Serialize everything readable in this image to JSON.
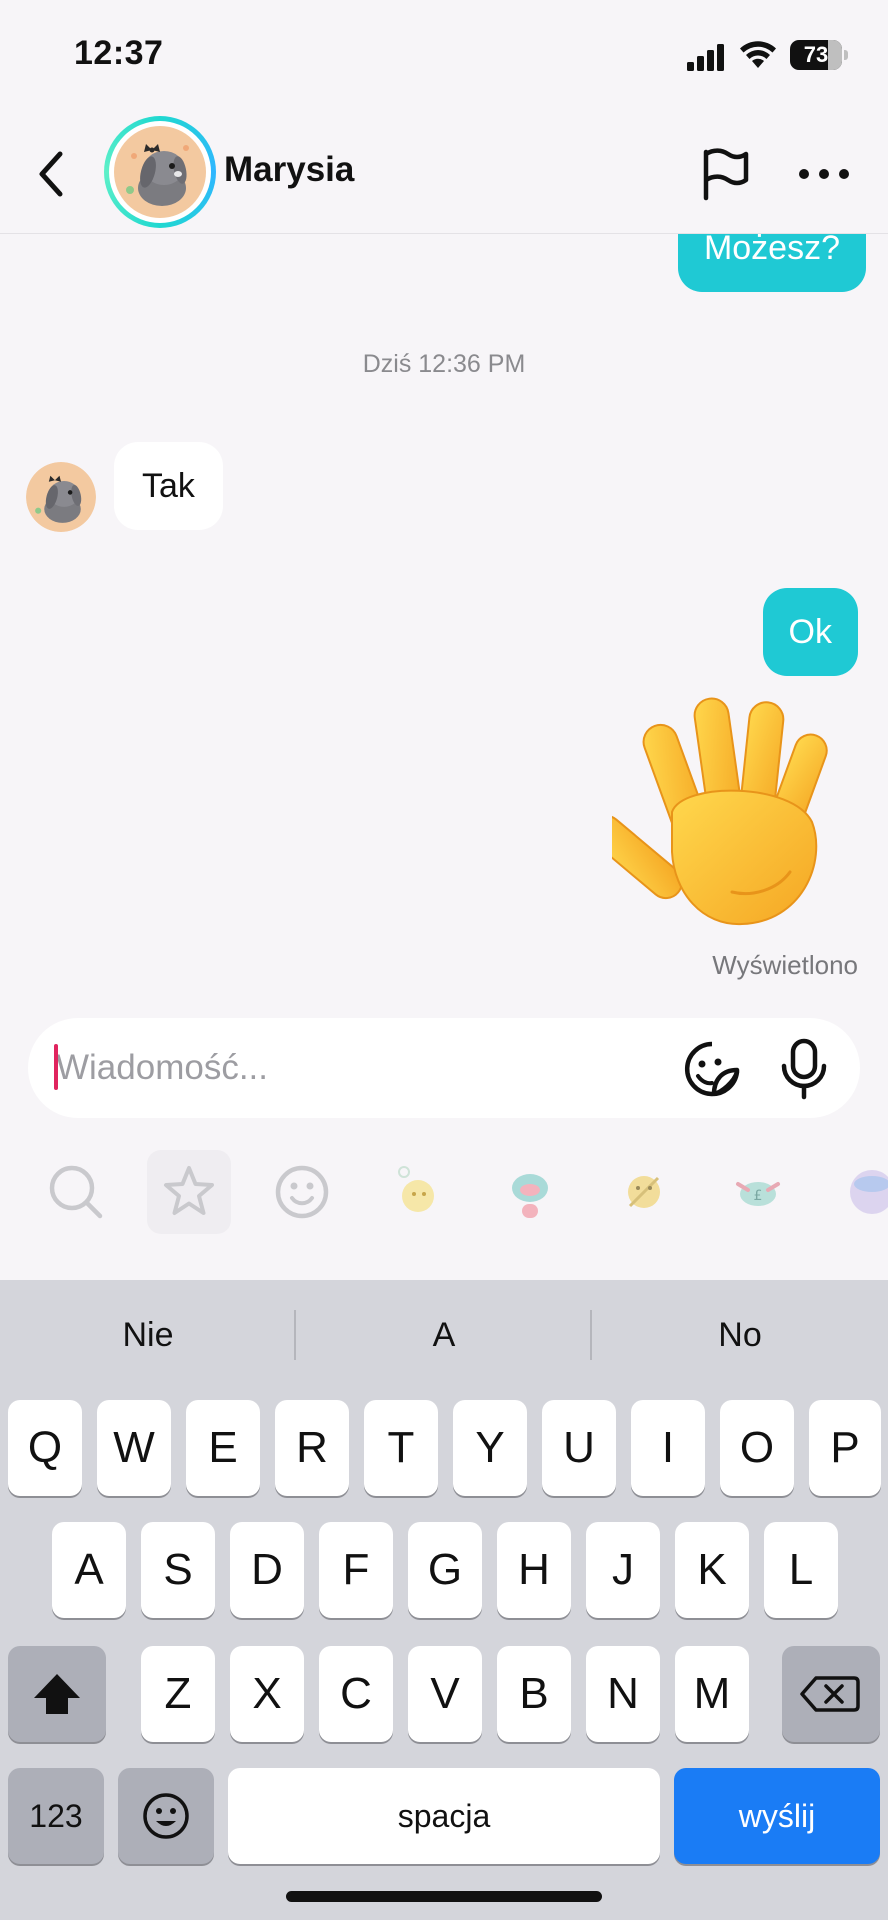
{
  "status_bar": {
    "time": "12:37",
    "battery_percent": "73",
    "icons": [
      "signal-icon",
      "wifi-icon",
      "battery-icon"
    ]
  },
  "header": {
    "contact_name": "Marysia",
    "icons": [
      "back-icon",
      "avatar",
      "flag-icon",
      "more-icon"
    ]
  },
  "chat": {
    "messages": [
      {
        "direction": "outgoing",
        "text": "Możesz?"
      },
      {
        "direction": "incoming",
        "text": "Tak"
      },
      {
        "direction": "outgoing",
        "text": "Ok"
      },
      {
        "direction": "outgoing",
        "emoji": "waving-hand"
      }
    ],
    "timestamp": "Dziś 12:36 PM",
    "seen_label": "Wyświetlono",
    "colors": {
      "outgoing_bubble": "#1fc9d4",
      "incoming_bubble": "#ffffff"
    }
  },
  "input": {
    "placeholder": "Wiadomość...",
    "value": "",
    "icons": [
      "sticker-icon",
      "mic-icon"
    ]
  },
  "sticker_tray": {
    "items": [
      "search-icon",
      "star-icon",
      "emoji-icon",
      "sticker-1",
      "sticker-2",
      "sticker-3",
      "sticker-4",
      "sticker-5"
    ]
  },
  "keyboard": {
    "suggestions": [
      "Nie",
      "A",
      "No"
    ],
    "row1": [
      "Q",
      "W",
      "E",
      "R",
      "T",
      "Y",
      "U",
      "I",
      "O",
      "P"
    ],
    "row2": [
      "A",
      "S",
      "D",
      "F",
      "G",
      "H",
      "J",
      "K",
      "L"
    ],
    "row3": [
      "Z",
      "X",
      "C",
      "V",
      "B",
      "N",
      "M"
    ],
    "numbers_label": "123",
    "space_label": "spacja",
    "send_label": "wyślij",
    "send_color": "#1a7cf5"
  }
}
